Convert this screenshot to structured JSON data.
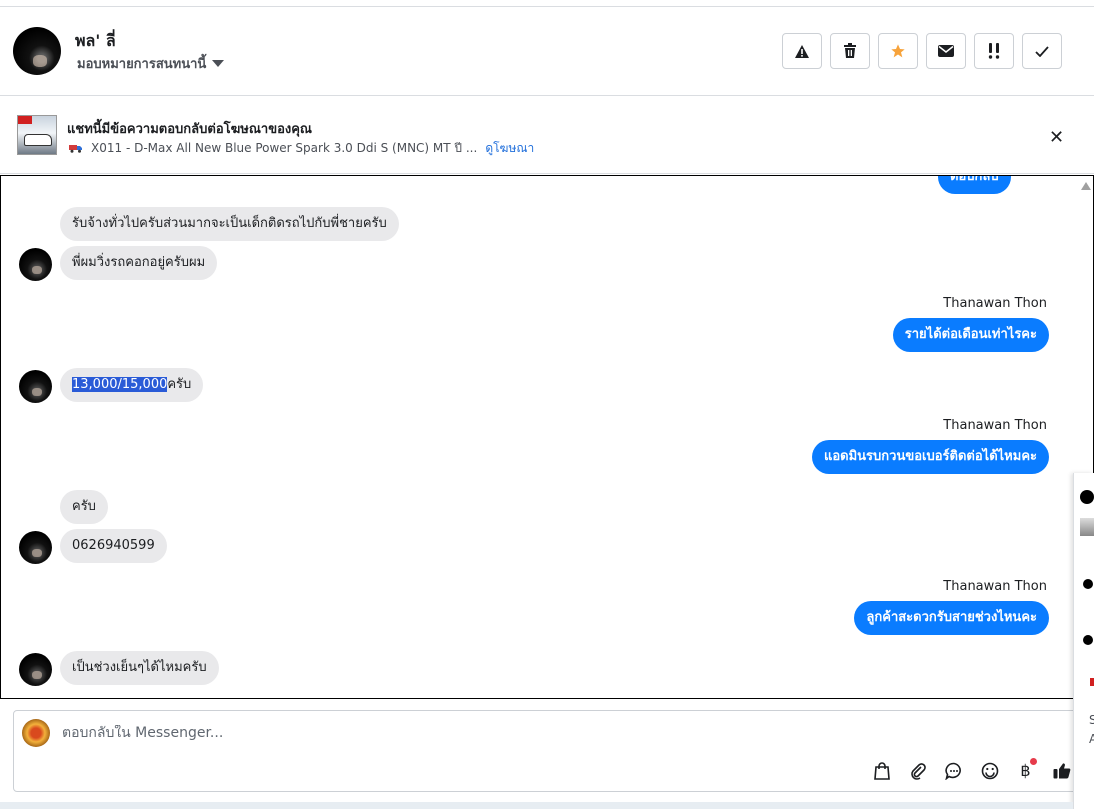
{
  "header": {
    "name": "พล' ลี่",
    "assign_label": "มอบหมายการสนทนานี้",
    "actions": [
      {
        "icon": "warning-icon",
        "glyph": "▲"
      },
      {
        "icon": "trash-icon",
        "glyph": "🗑"
      },
      {
        "icon": "star-icon",
        "glyph": "★"
      },
      {
        "icon": "mail-icon",
        "glyph": "✉"
      },
      {
        "icon": "urgent-icon",
        "glyph": "!!"
      },
      {
        "icon": "check-icon",
        "glyph": "✓"
      }
    ]
  },
  "ad_bar": {
    "title": "แชทนี้มีข้อความตอบกลับต่อโฆษณาของคุณ",
    "ad_text": "X011 - D-Max All New Blue Power Spark 3.0 Ddi S (MNC) MT ปี ...",
    "ad_link": "ดูโฆษณา"
  },
  "messages": {
    "top_partial": "ตอบกลับ",
    "m1": "รับจ้างทั่วไปครับส่วนมากจะเป็นเด็กติดรถไปกับพี่ชายครับ",
    "m2": "พี่ผมวิ่งรถคอกอยู่ครับผม",
    "sender1": "Thanawan Thon",
    "m3": "รายได้ต่อเดือนเท่าไรคะ",
    "m4_selected": "13,000/15,000",
    "m4_rest": "ครับ",
    "sender2": "Thanawan Thon",
    "m5": "แอดมินรบกวนขอเบอร์ติดต่อได้ไหมคะ",
    "m6": "ครับ",
    "m7": "0626940599",
    "sender3": "Thanawan Thon",
    "m8": "ลูกค้าสะดวกรับสายช่วงไหนคะ",
    "m9": "เป็นช่วงเย็นๆได้ไหมครับ"
  },
  "composer": {
    "placeholder": "ตอบกลับใน Messenger...",
    "tools": [
      "shopping-bag-icon",
      "paperclip-icon",
      "saved-reply-icon",
      "emoji-icon",
      "baht-payment-icon",
      "thumbs-up-icon"
    ],
    "baht_glyph": "฿"
  },
  "side_panel": {
    "text1": "S",
    "text2": "A"
  }
}
